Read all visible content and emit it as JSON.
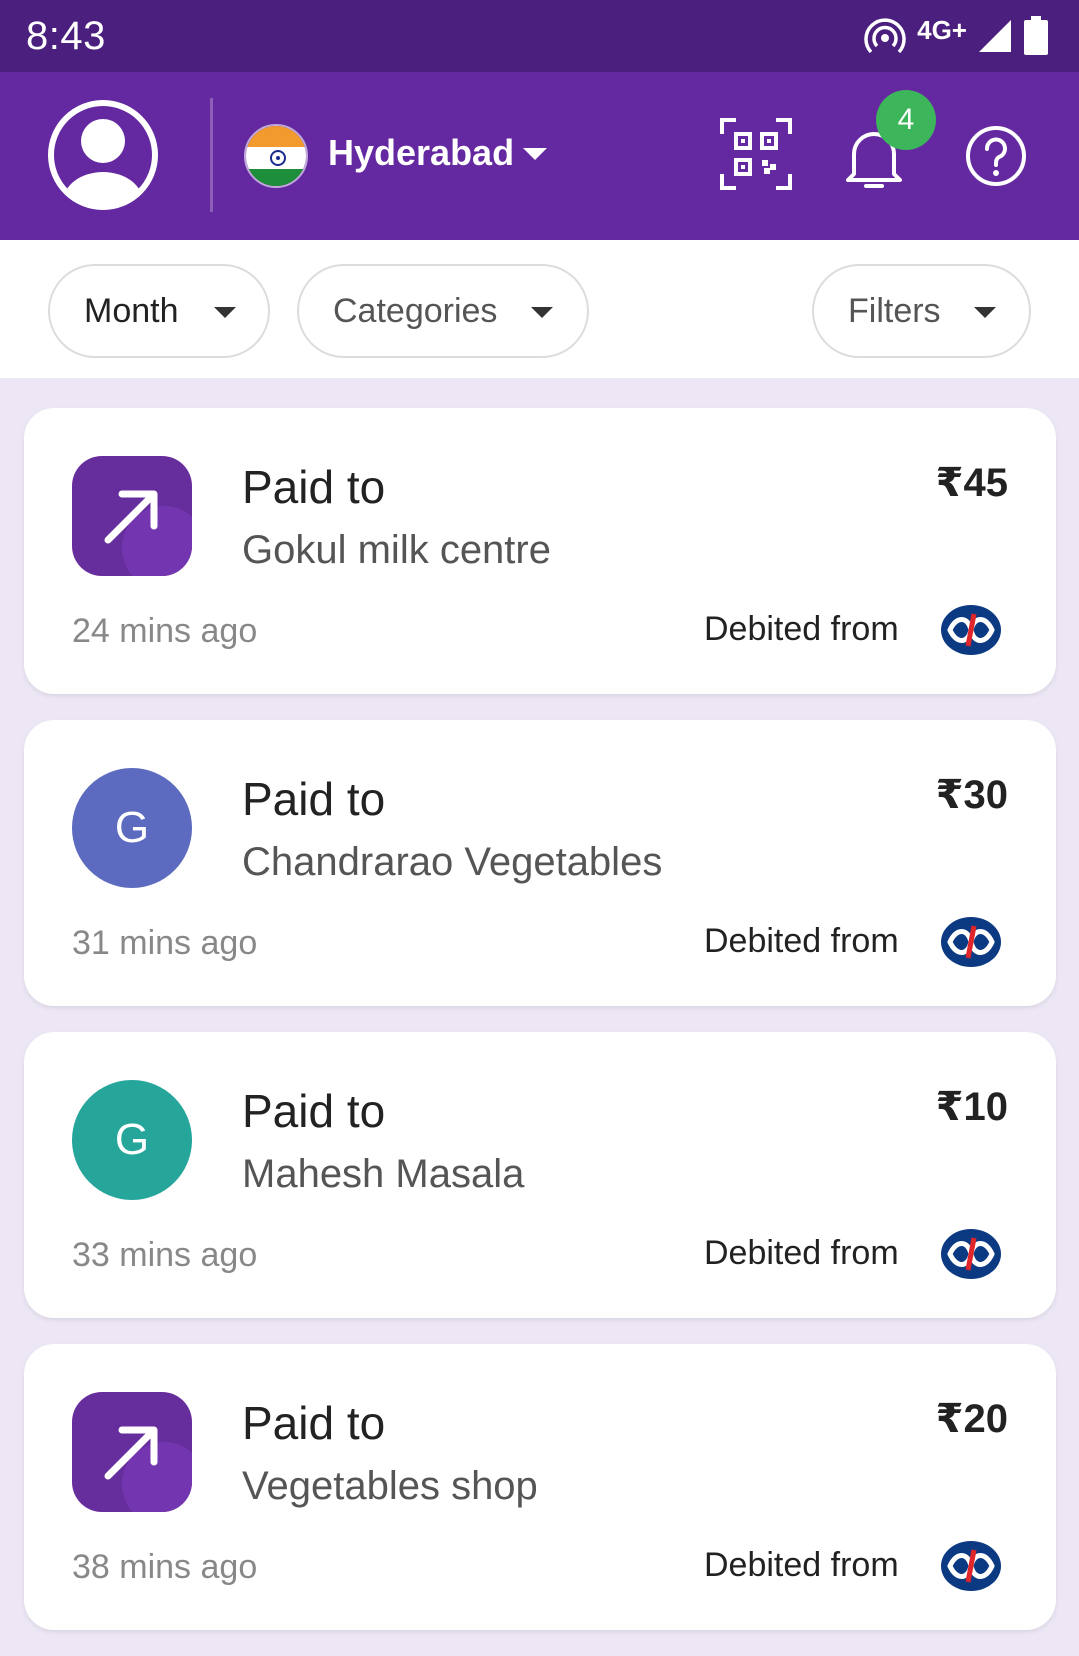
{
  "status_bar": {
    "time": "8:43",
    "network": "4G+"
  },
  "app_bar": {
    "city": "Hyderabad",
    "notification_count": "4"
  },
  "filters": {
    "month": "Month",
    "categories": "Categories",
    "filters": "Filters"
  },
  "colors": {
    "header": "#6428a0",
    "status_bar": "#4a1f7e",
    "badge": "#3db55a",
    "accent_purple": "#652e9c"
  },
  "transactions": [
    {
      "label": "Paid to",
      "merchant": "Gokul milk centre",
      "amount": "₹45",
      "time": "24 mins ago",
      "debit_label": "Debited from",
      "icon": "arrow-up-right-icon"
    },
    {
      "label": "Paid to",
      "merchant": "Chandrarao Vegetables",
      "amount": "₹30",
      "time": "31 mins ago",
      "debit_label": "Debited from",
      "icon_letter": "G",
      "icon_color": "#5c6bc0"
    },
    {
      "label": "Paid to",
      "merchant": "Mahesh Masala",
      "amount": "₹10",
      "time": "33 mins ago",
      "debit_label": "Debited from",
      "icon_letter": "G",
      "icon_color": "#26a69a"
    },
    {
      "label": "Paid to",
      "merchant": "Vegetables shop",
      "amount": "₹20",
      "time": "38 mins ago",
      "debit_label": "Debited from",
      "icon": "arrow-up-right-icon"
    }
  ]
}
